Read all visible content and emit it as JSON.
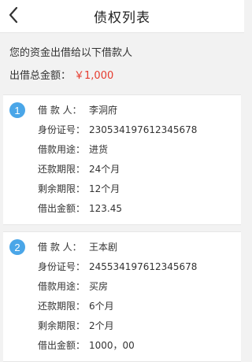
{
  "header": {
    "title": "债权列表"
  },
  "summary": {
    "line1": "您的资金出借给以下借款人",
    "total_label": "出借总金额：",
    "total_amount": "￥1,000"
  },
  "colors": {
    "accent_blue": "#4aa6e8",
    "amount_red": "#e63b2e"
  },
  "loans": [
    {
      "index": "1",
      "borrower_label": "借 款 人：",
      "borrower": "李洞府",
      "id_label": "身份证号：",
      "id_number": "230534197612345678",
      "purpose_label": "借款用途：",
      "purpose": "进货",
      "term_label": "还款期限：",
      "term": "24个月",
      "remaining_label": "剩余期限：",
      "remaining": "12个月",
      "lent_label": "借出金额：",
      "lent_amount": "123.45"
    },
    {
      "index": "2",
      "borrower_label": "借 款 人：",
      "borrower": "王本剧",
      "id_label": "身份证号：",
      "id_number": "245534197612345678",
      "purpose_label": "借款用途：",
      "purpose": "买房",
      "term_label": "还款期限：",
      "term": "6个月",
      "remaining_label": "剩余期限：",
      "remaining": "2个月",
      "lent_label": "借出金额：",
      "lent_amount": "1000，00"
    }
  ]
}
